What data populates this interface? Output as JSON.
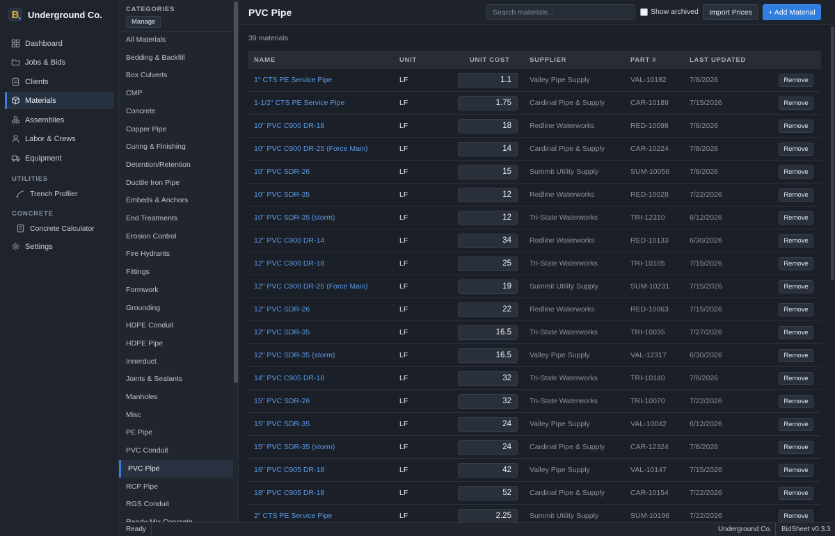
{
  "app": {
    "name": "Underground Co.",
    "logo_letter": "B"
  },
  "nav": {
    "items": [
      {
        "label": "Dashboard",
        "icon": "grid-icon"
      },
      {
        "label": "Jobs & Bids",
        "icon": "folder-icon"
      },
      {
        "label": "Clients",
        "icon": "clipboard-icon"
      },
      {
        "label": "Materials",
        "icon": "box-icon",
        "active": true
      },
      {
        "label": "Assemblies",
        "icon": "stack-icon"
      },
      {
        "label": "Labor & Crews",
        "icon": "user-icon"
      },
      {
        "label": "Equipment",
        "icon": "truck-icon"
      }
    ],
    "utilities_label": "UTILITIES",
    "utilities": [
      {
        "label": "Trench Profiler",
        "icon": "curve-icon"
      }
    ],
    "concrete_label": "CONCRETE",
    "concrete": [
      {
        "label": "Concrete Calculator",
        "icon": "calculator-icon"
      }
    ],
    "settings": {
      "label": "Settings",
      "icon": "gear-icon"
    }
  },
  "categories": {
    "title": "CATEGORIES",
    "manage_label": "Manage",
    "active": "PVC Pipe",
    "items": [
      "All Materials",
      "Bedding & Backfill",
      "Box Culverts",
      "CMP",
      "Concrete",
      "Copper Pipe",
      "Curing & Finishing",
      "Detention/Retention",
      "Ductile Iron Pipe",
      "Embeds & Anchors",
      "End Treatments",
      "Erosion Control",
      "Fire Hydrants",
      "Fittings",
      "Formwork",
      "Grounding",
      "HDPE Conduit",
      "HDPE Pipe",
      "Innerduct",
      "Joints & Sealants",
      "Manholes",
      "Misc",
      "PE Pipe",
      "PVC Conduit",
      "PVC Pipe",
      "RCP Pipe",
      "RGS Conduit",
      "Ready-Mix Concrete"
    ]
  },
  "main": {
    "title": "PVC Pipe",
    "search_placeholder": "Search materials...",
    "show_archived_label": "Show archived",
    "import_label": "Import Prices",
    "add_label": "+ Add Material",
    "count_label": "39 materials",
    "columns": {
      "name": "NAME",
      "unit": "UNIT",
      "unit_cost": "UNIT COST",
      "supplier": "SUPPLIER",
      "part": "PART #",
      "updated": "LAST UPDATED"
    },
    "remove_label": "Remove",
    "rows": [
      {
        "name": "1\" CTS PE Service Pipe",
        "unit": "LF",
        "cost": "1.1",
        "supplier": "Valley Pipe Supply",
        "part": "VAL-10182",
        "updated": "7/8/2026"
      },
      {
        "name": "1-1/2\" CTS PE Service Pipe",
        "unit": "LF",
        "cost": "1.75",
        "supplier": "Cardinal Pipe & Supply",
        "part": "CAR-10189",
        "updated": "7/15/2026"
      },
      {
        "name": "10\" PVC C900 DR-18",
        "unit": "LF",
        "cost": "18",
        "supplier": "Redline Waterworks",
        "part": "RED-10098",
        "updated": "7/8/2026"
      },
      {
        "name": "10\" PVC C900 DR-25 (Force Main)",
        "unit": "LF",
        "cost": "14",
        "supplier": "Cardinal Pipe & Supply",
        "part": "CAR-10224",
        "updated": "7/8/2026"
      },
      {
        "name": "10\" PVC SDR-26",
        "unit": "LF",
        "cost": "15",
        "supplier": "Summit Utility Supply",
        "part": "SUM-10056",
        "updated": "7/8/2026"
      },
      {
        "name": "10\" PVC SDR-35",
        "unit": "LF",
        "cost": "12",
        "supplier": "Redline Waterworks",
        "part": "RED-10028",
        "updated": "7/22/2026"
      },
      {
        "name": "10\" PVC SDR-35 (storm)",
        "unit": "LF",
        "cost": "12",
        "supplier": "Tri-State Waterworks",
        "part": "TRI-12310",
        "updated": "6/12/2026"
      },
      {
        "name": "12\" PVC C900 DR-14",
        "unit": "LF",
        "cost": "34",
        "supplier": "Redline Waterworks",
        "part": "RED-10133",
        "updated": "6/30/2026"
      },
      {
        "name": "12\" PVC C900 DR-18",
        "unit": "LF",
        "cost": "25",
        "supplier": "Tri-State Waterworks",
        "part": "TRI-10105",
        "updated": "7/15/2026"
      },
      {
        "name": "12\" PVC C900 DR-25 (Force Main)",
        "unit": "LF",
        "cost": "19",
        "supplier": "Summit Utility Supply",
        "part": "SUM-10231",
        "updated": "7/15/2026"
      },
      {
        "name": "12\" PVC SDR-26",
        "unit": "LF",
        "cost": "22",
        "supplier": "Redline Waterworks",
        "part": "RED-10063",
        "updated": "7/15/2026"
      },
      {
        "name": "12\" PVC SDR-35",
        "unit": "LF",
        "cost": "16.5",
        "supplier": "Tri-State Waterworks",
        "part": "TRI-10035",
        "updated": "7/27/2026"
      },
      {
        "name": "12\" PVC SDR-35 (storm)",
        "unit": "LF",
        "cost": "16.5",
        "supplier": "Valley Pipe Supply",
        "part": "VAL-12317",
        "updated": "6/30/2026"
      },
      {
        "name": "14\" PVC C905 DR-18",
        "unit": "LF",
        "cost": "32",
        "supplier": "Tri-State Waterworks",
        "part": "TRI-10140",
        "updated": "7/8/2026"
      },
      {
        "name": "15\" PVC SDR-26",
        "unit": "LF",
        "cost": "32",
        "supplier": "Tri-State Waterworks",
        "part": "TRI-10070",
        "updated": "7/22/2026"
      },
      {
        "name": "15\" PVC SDR-35",
        "unit": "LF",
        "cost": "24",
        "supplier": "Valley Pipe Supply",
        "part": "VAL-10042",
        "updated": "6/12/2026"
      },
      {
        "name": "15\" PVC SDR-35 (storm)",
        "unit": "LF",
        "cost": "24",
        "supplier": "Cardinal Pipe & Supply",
        "part": "CAR-12324",
        "updated": "7/8/2026"
      },
      {
        "name": "16\" PVC C905 DR-18",
        "unit": "LF",
        "cost": "42",
        "supplier": "Valley Pipe Supply",
        "part": "VAL-10147",
        "updated": "7/15/2026"
      },
      {
        "name": "18\" PVC C905 DR-18",
        "unit": "LF",
        "cost": "52",
        "supplier": "Cardinal Pipe & Supply",
        "part": "CAR-10154",
        "updated": "7/22/2026"
      },
      {
        "name": "2\" CTS PE Service Pipe",
        "unit": "LF",
        "cost": "2.25",
        "supplier": "Summit Utility Supply",
        "part": "SUM-10196",
        "updated": "7/22/2026"
      }
    ]
  },
  "status": {
    "ready": "Ready",
    "company": "Underground Co.",
    "version": "BidSheet v0.3.3"
  },
  "colors": {
    "accent": "#2f7de1",
    "link": "#5b9ae6",
    "background": "#1b1f27",
    "sidebar": "#1e232c"
  }
}
